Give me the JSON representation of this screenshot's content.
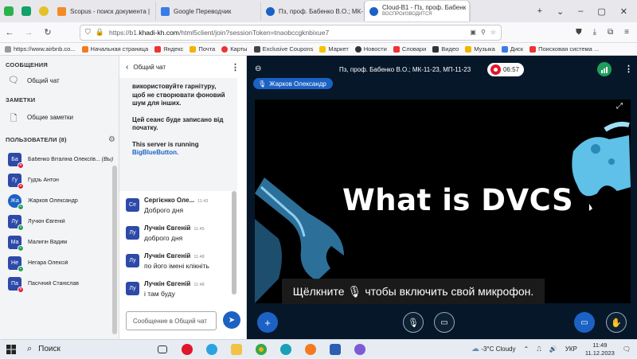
{
  "browser": {
    "tabs": [
      {
        "label": "Scopus - поиск документа |",
        "color": "#f28c28"
      },
      {
        "label": "Google Переводчик",
        "color": "#3b7be8"
      },
      {
        "label": "Пз, проф. Бабенко В.О.; МК-",
        "color": "#1b62c4"
      },
      {
        "label": "Cloud-B1 - Пз, проф. Бабенк",
        "sub": "ВОСПРОИЗВОДИТСЯ",
        "color": "#1b62c4"
      }
    ],
    "url_prefix": "https://b1.",
    "url_domain": "khadi-kh.com",
    "url_rest": "/html5client/join?sessionToken=tnaobccgknbixue7",
    "bookmarks": [
      "https://www.airbnb.co...",
      "Начальная страница",
      "Яндекс",
      "Почта",
      "Карты",
      "Exclusive Coupons",
      "Маркет",
      "Новости",
      "Словари",
      "Видео",
      "Музыка",
      "Диск",
      "Поисковая система ..."
    ]
  },
  "left": {
    "messages_header": "СООБЩЕНИЯ",
    "public_chat": "Общий чат",
    "notes_header": "ЗАМЕТКИ",
    "shared_notes": "Общие заметки",
    "users_header": "ПОЛЬЗОВАТЕЛИ (8)",
    "users": [
      {
        "initials": "Ба",
        "name": "Бабенко Віталіна Олексіїв...",
        "you": "(Вы)",
        "color": "#2d4aa8",
        "status": "#e0162b"
      },
      {
        "initials": "Гу",
        "name": "Гудзь Антон",
        "color": "#2d4aa8",
        "status": "#e0162b"
      },
      {
        "initials": "Жа",
        "name": "Жарков Олександр",
        "color": "#1b62c4",
        "status": "#1f9e5b"
      },
      {
        "initials": "Лу",
        "name": "Лучкін Євгеній",
        "color": "#2d4aa8",
        "status": "#1f9e5b"
      },
      {
        "initials": "Ма",
        "name": "Малигін Вадим",
        "color": "#2d4aa8",
        "status": "#1f9e5b"
      },
      {
        "initials": "Не",
        "name": "Негара Олексій",
        "color": "#2d4aa8",
        "status": "#1f9e5b"
      },
      {
        "initials": "Па",
        "name": "Пасічний Станіслав",
        "color": "#2d4aa8",
        "status": "#e0162b"
      }
    ]
  },
  "chat": {
    "title": "Общий чат",
    "welcome_1": "використовуйте гарнітуру, щоб не створювати фоновий шум для інших.",
    "welcome_2": "Цей сеанс буде записано від початку.",
    "welcome_3": "This server is running",
    "welcome_link": "BigBlueButton.",
    "messages": [
      {
        "initials": "Се",
        "name": "Сергієнко Оле...",
        "time": "11:43",
        "text": "Доброго дня",
        "color": "#2d4aa8"
      },
      {
        "initials": "Лу",
        "name": "Лучкін Євгеній",
        "time": "11:45",
        "text": "доброго дня",
        "color": "#2d4aa8"
      },
      {
        "initials": "Лу",
        "name": "Лучкін Євгеній",
        "time": "11:48",
        "text": "по його імені клікніть",
        "color": "#2d4aa8"
      },
      {
        "initials": "Лу",
        "name": "Лучкін Євгеній",
        "time": "11:48",
        "text": "і там буду",
        "color": "#2d4aa8"
      }
    ],
    "input_placeholder": "Сообщение в Общий чат"
  },
  "stage": {
    "title": "Пз, проф. Бабенко В.О.; МК-11-23, МП-11-23",
    "timer": "06:57",
    "talker": "Жарков Олександр",
    "slide_title": "What is DVCS",
    "caption_before": "Щёлкните",
    "caption_after": "чтобы включить свой микрофон.",
    "colors": {
      "accent": "#1b62c4",
      "record": "#e0162b",
      "connection": "#1f9e5b"
    }
  },
  "taskbar": {
    "search_label": "Поиск",
    "weather": "-3°C  Cloudy",
    "lang": "УКР",
    "time": "11:49",
    "date": "11.12.2023"
  }
}
